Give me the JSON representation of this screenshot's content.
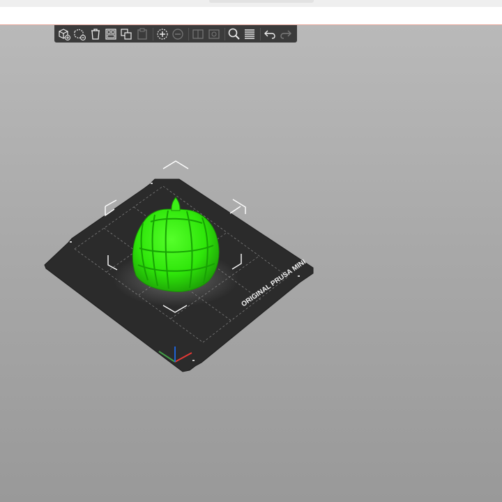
{
  "toolbar": {
    "buttons": [
      {
        "name": "add-object-button",
        "icon": "cube-add-icon",
        "enabled": true
      },
      {
        "name": "remove-object-button",
        "icon": "cube-remove-icon",
        "enabled": true
      },
      {
        "name": "delete-all-button",
        "icon": "trash-icon",
        "enabled": true
      },
      {
        "name": "arrange-button",
        "icon": "arrange-icon",
        "enabled": true
      },
      {
        "name": "copy-button",
        "icon": "copy-icon",
        "enabled": true
      },
      {
        "name": "paste-button",
        "icon": "paste-icon",
        "enabled": false
      },
      {
        "name": "add-instance-button",
        "icon": "plus-circle-icon",
        "enabled": true
      },
      {
        "name": "remove-instance-button",
        "icon": "minus-circle-icon",
        "enabled": false
      },
      {
        "name": "split-objects-button",
        "icon": "split-objects-icon",
        "enabled": false
      },
      {
        "name": "split-parts-button",
        "icon": "split-parts-icon",
        "enabled": false
      },
      {
        "name": "search-button",
        "icon": "search-icon",
        "enabled": true
      },
      {
        "name": "layers-button",
        "icon": "layers-icon",
        "enabled": true
      },
      {
        "name": "undo-button",
        "icon": "undo-icon",
        "enabled": true
      },
      {
        "name": "redo-button",
        "icon": "redo-icon",
        "enabled": false
      }
    ]
  },
  "bed": {
    "label": "ORIGINAL PRUSA MINI",
    "color": "#2b2b2b",
    "model_color": "#2fe60a",
    "axis_colors": {
      "x": "#e53935",
      "y": "#43a047",
      "z": "#1e63d6"
    }
  }
}
